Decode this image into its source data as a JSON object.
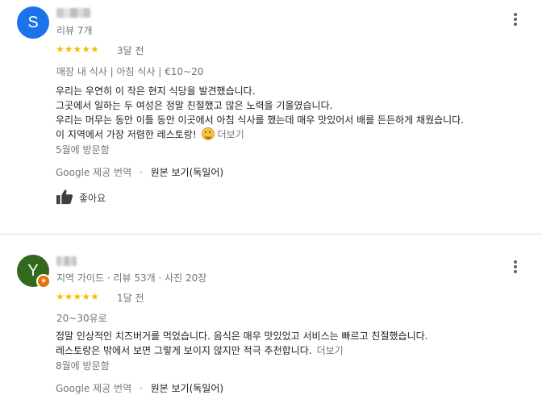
{
  "reviews": [
    {
      "avatar_letter": "S",
      "avatar_color": "#1a73e8",
      "reviewer_meta": "리뷰 7개",
      "rating": 5,
      "stars": "★★★★★",
      "time_ago": "3달 전",
      "tags": "매장 내 식사 | 아침 식사 | €10~20",
      "text_lines": [
        "우리는 우연히 이 작은 현지 식당을 발견했습니다.",
        "그곳에서 일하는 두 여성은 정말 친절했고 많은 노력을 기울였습니다.",
        "우리는 머무는 동안 이틀 동안 이곳에서 아침 식사를 했는데 매우 맛있어서 배를 든든하게 채웠습니다.",
        "이 지역에서 가장 저렴한 레스토랑!"
      ],
      "more_label": "더보기",
      "visit": "5월에 방문함",
      "translation_label": "Google 제공 번역",
      "translation_sep": "·",
      "original_label": "원본 보기(독일어)",
      "like_label": "좋아요"
    },
    {
      "avatar_letter": "Y",
      "avatar_color": "#33691e",
      "badge_color": "#e8710a",
      "reviewer_meta": "지역 가이드 · 리뷰 53개 · 사진 20장",
      "rating": 5,
      "stars": "★★★★★",
      "time_ago": "1달 전",
      "price": "20~30유로",
      "text_lines": [
        "정말 인상적인 치즈버거를 먹었습니다. 음식은 매우 맛있었고 서비스는 빠르고 친절했습니다.",
        "레스토랑은 밖에서 보면 그렇게 보이지 않지만 적극 추천합니다."
      ],
      "more_label": "더보기",
      "visit": "8월에 방문함",
      "translation_label": "Google 제공 번역",
      "translation_sep": "·",
      "original_label": "원본 보기(독일어)"
    }
  ]
}
